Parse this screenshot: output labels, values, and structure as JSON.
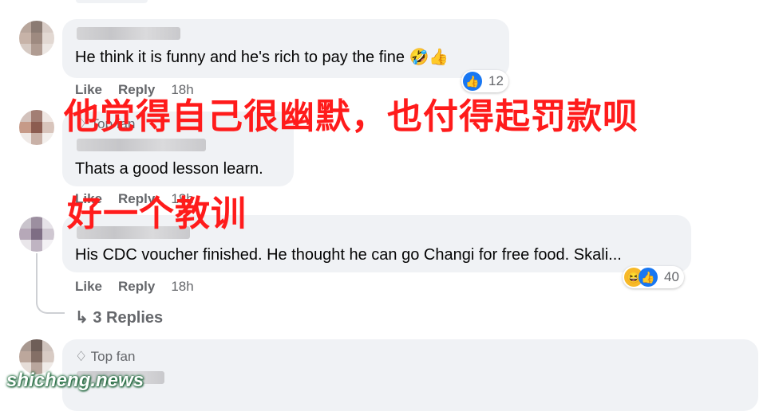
{
  "comments": [
    {
      "text": "He think it is funny and he's rich to pay the fine",
      "emoji": "🤣👍",
      "actions": {
        "like": "Like",
        "reply": "Reply",
        "time": "18h"
      },
      "reactions": {
        "count": "12",
        "icons": [
          "like-icon"
        ]
      }
    },
    {
      "badge": "Top fan",
      "text": "Thats a good lesson learn.",
      "actions": {
        "like": "Like",
        "reply": "Reply",
        "time": "18h"
      }
    },
    {
      "text": "His CDC voucher finished. He thought he can go Changi for free food. Skali...",
      "actions": {
        "like": "Like",
        "reply": "Reply",
        "time": "18h"
      },
      "reactions": {
        "count": "40",
        "icons": [
          "haha-icon",
          "like-icon"
        ]
      },
      "replies": "3 Replies"
    },
    {
      "badge": "Top fan"
    }
  ],
  "overlays": {
    "caption1": "他觉得自己很幽默，也付得起罚款呗",
    "caption2": "好一个教训"
  },
  "watermark": "shicheng.news",
  "colors": {
    "bubble": "#f0f2f5",
    "muted": "#65676b",
    "overlay": "#ff1b1b",
    "like": "#1877f2"
  }
}
